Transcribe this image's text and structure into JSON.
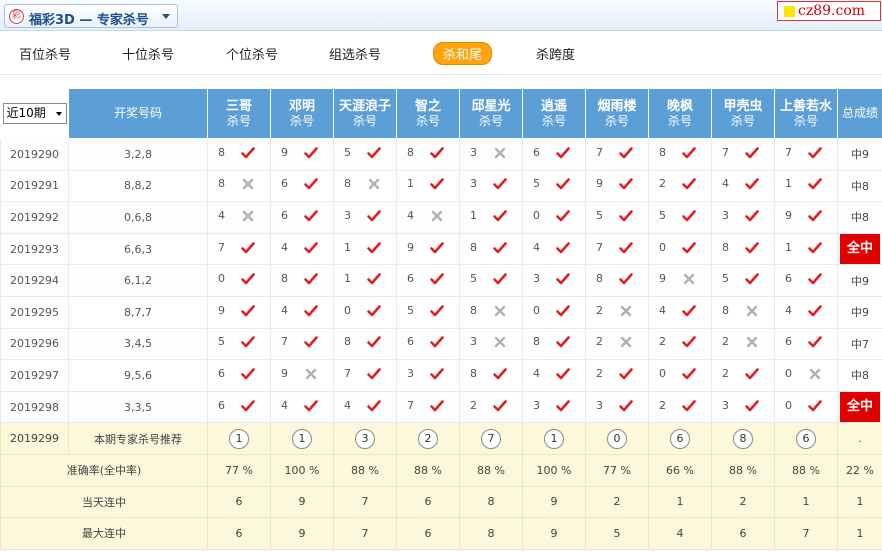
{
  "header": {
    "title": "福彩3D — 专家杀号",
    "brand": "cz89.com"
  },
  "nav": [
    "百位杀号",
    "十位杀号",
    "个位杀号",
    "组选杀号",
    "杀和尾",
    "杀跨度"
  ],
  "nav_active": 4,
  "table": {
    "period_select": "近10期",
    "col_numbers": "开奖号码",
    "col_total": "总成绩",
    "experts": [
      {
        "name": "三哥",
        "sub": "杀号"
      },
      {
        "name": "邓明",
        "sub": "杀号"
      },
      {
        "name": "天涯浪子",
        "sub": "杀号"
      },
      {
        "name": "智之",
        "sub": "杀号"
      },
      {
        "name": "邱星光",
        "sub": "杀号"
      },
      {
        "name": "逍遥",
        "sub": "杀号"
      },
      {
        "name": "烟雨楼",
        "sub": "杀号"
      },
      {
        "name": "晚枫",
        "sub": "杀号"
      },
      {
        "name": "甲壳虫",
        "sub": "杀号"
      },
      {
        "name": "上善若水",
        "sub": "杀号"
      }
    ],
    "rows": [
      {
        "issue": "2019290",
        "numbers": "3,2,8",
        "kills": [
          [
            "8",
            "y"
          ],
          [
            "9",
            "y"
          ],
          [
            "5",
            "y"
          ],
          [
            "8",
            "y"
          ],
          [
            "3",
            "n"
          ],
          [
            "6",
            "y"
          ],
          [
            "7",
            "y"
          ],
          [
            "8",
            "y"
          ],
          [
            "7",
            "y"
          ],
          [
            "7",
            "y"
          ]
        ],
        "total": "中9",
        "full": false
      },
      {
        "issue": "2019291",
        "numbers": "8,8,2",
        "kills": [
          [
            "8",
            "n"
          ],
          [
            "6",
            "y"
          ],
          [
            "8",
            "n"
          ],
          [
            "1",
            "y"
          ],
          [
            "3",
            "y"
          ],
          [
            "5",
            "y"
          ],
          [
            "9",
            "y"
          ],
          [
            "2",
            "y"
          ],
          [
            "4",
            "y"
          ],
          [
            "1",
            "y"
          ]
        ],
        "total": "中8",
        "full": false
      },
      {
        "issue": "2019292",
        "numbers": "0,6,8",
        "kills": [
          [
            "4",
            "n"
          ],
          [
            "6",
            "y"
          ],
          [
            "3",
            "y"
          ],
          [
            "4",
            "n"
          ],
          [
            "1",
            "y"
          ],
          [
            "0",
            "y"
          ],
          [
            "5",
            "y"
          ],
          [
            "5",
            "y"
          ],
          [
            "3",
            "y"
          ],
          [
            "9",
            "y"
          ]
        ],
        "total": "中8",
        "full": false
      },
      {
        "issue": "2019293",
        "numbers": "6,6,3",
        "kills": [
          [
            "7",
            "y"
          ],
          [
            "4",
            "y"
          ],
          [
            "1",
            "y"
          ],
          [
            "9",
            "y"
          ],
          [
            "8",
            "y"
          ],
          [
            "4",
            "y"
          ],
          [
            "7",
            "y"
          ],
          [
            "0",
            "y"
          ],
          [
            "8",
            "y"
          ],
          [
            "1",
            "y"
          ]
        ],
        "total": "全中",
        "full": true
      },
      {
        "issue": "2019294",
        "numbers": "6,1,2",
        "kills": [
          [
            "0",
            "y"
          ],
          [
            "8",
            "y"
          ],
          [
            "1",
            "y"
          ],
          [
            "6",
            "y"
          ],
          [
            "5",
            "y"
          ],
          [
            "3",
            "y"
          ],
          [
            "8",
            "y"
          ],
          [
            "9",
            "n"
          ],
          [
            "5",
            "y"
          ],
          [
            "6",
            "y"
          ]
        ],
        "total": "中9",
        "full": false
      },
      {
        "issue": "2019295",
        "numbers": "8,7,7",
        "kills": [
          [
            "9",
            "y"
          ],
          [
            "4",
            "y"
          ],
          [
            "0",
            "y"
          ],
          [
            "5",
            "y"
          ],
          [
            "8",
            "n"
          ],
          [
            "0",
            "y"
          ],
          [
            "2",
            "n"
          ],
          [
            "4",
            "y"
          ],
          [
            "8",
            "n"
          ],
          [
            "4",
            "y"
          ]
        ],
        "total": "中9",
        "full": false
      },
      {
        "issue": "2019296",
        "numbers": "3,4,5",
        "kills": [
          [
            "5",
            "y"
          ],
          [
            "7",
            "y"
          ],
          [
            "8",
            "y"
          ],
          [
            "6",
            "y"
          ],
          [
            "3",
            "n"
          ],
          [
            "8",
            "y"
          ],
          [
            "2",
            "n"
          ],
          [
            "2",
            "y"
          ],
          [
            "2",
            "n"
          ],
          [
            "6",
            "y"
          ]
        ],
        "total": "中7",
        "full": false
      },
      {
        "issue": "2019297",
        "numbers": "9,5,6",
        "kills": [
          [
            "6",
            "y"
          ],
          [
            "9",
            "n"
          ],
          [
            "7",
            "y"
          ],
          [
            "3",
            "y"
          ],
          [
            "8",
            "y"
          ],
          [
            "4",
            "y"
          ],
          [
            "2",
            "y"
          ],
          [
            "0",
            "y"
          ],
          [
            "2",
            "y"
          ],
          [
            "0",
            "n"
          ]
        ],
        "total": "中8",
        "full": false
      },
      {
        "issue": "2019298",
        "numbers": "3,3,5",
        "kills": [
          [
            "6",
            "y"
          ],
          [
            "4",
            "y"
          ],
          [
            "4",
            "y"
          ],
          [
            "7",
            "y"
          ],
          [
            "2",
            "y"
          ],
          [
            "3",
            "y"
          ],
          [
            "3",
            "y"
          ],
          [
            "2",
            "y"
          ],
          [
            "3",
            "y"
          ],
          [
            "0",
            "y"
          ]
        ],
        "total": "全中",
        "full": true
      }
    ],
    "recommend": {
      "issue": "2019299",
      "label": "本期专家杀号推荐",
      "values": [
        "1",
        "1",
        "3",
        "2",
        "7",
        "1",
        "0",
        "6",
        "8",
        "6"
      ],
      "total": "."
    },
    "accuracy": {
      "label": "准确率(全中率)",
      "values": [
        "77 %",
        "100 %",
        "88 %",
        "88 %",
        "88 %",
        "100 %",
        "77 %",
        "66 %",
        "88 %",
        "88 %"
      ],
      "total": "22 %"
    },
    "streak_today": {
      "label": "当天连中",
      "values": [
        "6",
        "9",
        "7",
        "6",
        "8",
        "9",
        "2",
        "1",
        "2",
        "1"
      ],
      "total": "1"
    },
    "streak_max": {
      "label": "最大连中",
      "values": [
        "6",
        "9",
        "7",
        "6",
        "8",
        "9",
        "5",
        "4",
        "6",
        "7"
      ],
      "total": "1"
    }
  },
  "colors": {
    "header_blue": "#5c9fd6",
    "hit_red": "#e02020",
    "miss_gray": "#b0b0b0",
    "full_red": "#e00000",
    "active_orange": "#ffa40c"
  }
}
